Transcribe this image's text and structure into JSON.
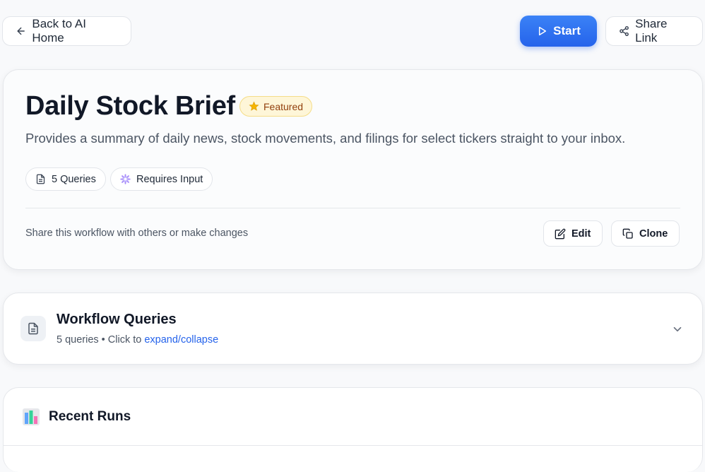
{
  "nav": {
    "back_label": "Back to AI Home",
    "start_label": "Start",
    "share_label": "Share Link"
  },
  "workflow": {
    "title": "Daily Stock Brief",
    "badge": "Featured",
    "description": "Provides a summary of daily news, stock movements, and filings for select tickers straight to your inbox.",
    "queries_pill": "5 Queries",
    "input_pill": "Requires Input",
    "share_text": "Share this workflow with others or make changes",
    "edit_label": "Edit",
    "clone_label": "Clone"
  },
  "queries_section": {
    "title": "Workflow Queries",
    "count_text": "5 queries",
    "separator": " • Click to ",
    "link_text": "expand/collapse"
  },
  "runs_section": {
    "title": "Recent Runs"
  },
  "colors": {
    "accent": "#2563eb",
    "badge_bg": "#fef6d8",
    "badge_text": "#92400e"
  },
  "icons": [
    "arrow-left-icon",
    "play-icon",
    "share-icon",
    "star-icon",
    "document-icon",
    "gear-icon",
    "edit-icon",
    "copy-icon",
    "chevron-down-icon",
    "bar-chart-icon"
  ]
}
